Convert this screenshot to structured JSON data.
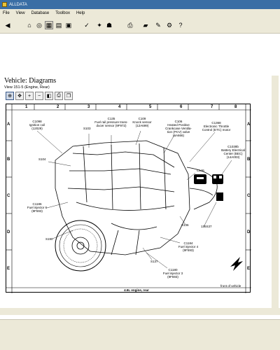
{
  "window": {
    "title": "ALLDATA"
  },
  "menu": [
    "File",
    "View",
    "Database",
    "Toolbox",
    "Help"
  ],
  "toolbar_icons": [
    "back-icon",
    "home-icon",
    "disc-icon",
    "diagram-icon",
    "tools-icon",
    "truck-icon",
    "new-cars-icon",
    "print-icon",
    "save-icon",
    "repair-icon",
    "contact-icon",
    "notes-icon"
  ],
  "page": {
    "title": "Vehicle: Diagrams",
    "view": "View 151-5 (Engine, Rear)"
  },
  "diagram_toolbar": [
    "zoom-fit-icon",
    "pan-icon",
    "zoom-in-icon",
    "zoom-out-icon",
    "prev-icon",
    "print-icon",
    "copy-icon"
  ],
  "ruler": {
    "columns": [
      "1",
      "2",
      "3",
      "4",
      "5",
      "6",
      "7",
      "8"
    ],
    "rows": [
      "A",
      "B",
      "C",
      "D",
      "E"
    ]
  },
  "callouts": {
    "c1098": "C1098\nIgnition coil\n(12029)",
    "c135": "C135\nFuel rail pressure trans-\nducer sensor (9F972)",
    "c109": "C109\nKnock sensor\n(12A699)",
    "c106": "C106\nHeated Positive\nCrankcase Ventila-\ntion (PCV) valve\n(6A666)",
    "c1368": "C1368\nElectronic Throttle\nControl (ETC) motor",
    "c1039b": "C1039b\nBattery Electrical\nCenter (BEC)\n(14A003)",
    "s103": "S103",
    "s104": "S104",
    "c146": "C146",
    "c1186": "C1186\nFuel injector 6\n(9F593)",
    "s136": "S136",
    "part135s37": "135S37",
    "s190": "S190",
    "c1184": "C1184\nFuel injector 4\n(9F593)",
    "s137": "S137",
    "c1180": "C1180\nFuel injector 3\n(9F593)",
    "caption": "4.6L engine, rear",
    "front_label": "front of vehicle"
  }
}
